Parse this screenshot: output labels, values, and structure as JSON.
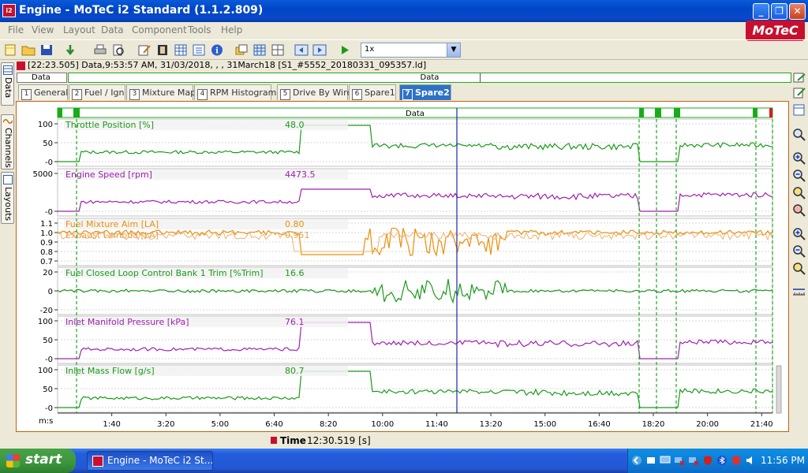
{
  "window": {
    "title": "Engine - MoTeC i2 Standard (1.1.2.809)"
  },
  "menu": [
    "File",
    "View",
    "Layout",
    "Data",
    "Component",
    "Tools",
    "Help"
  ],
  "logo": "MoTeC",
  "toolbar": {
    "zoom": "1x"
  },
  "file_info": "[22:23.505] Data,9:53:57 AM, 31/03/2018, , , 31March18 [S1_#5552_20180331_095357.ld]",
  "side_tabs": [
    "Data",
    "Channels",
    "Layouts"
  ],
  "data_row": {
    "left": "Data",
    "center": "Data"
  },
  "tabs": [
    {
      "num": "1",
      "label": "General"
    },
    {
      "num": "2",
      "label": "Fuel / Ign"
    },
    {
      "num": "3",
      "label": "Mixture Map"
    },
    {
      "num": "4",
      "label": "RPM Histogram"
    },
    {
      "num": "5",
      "label": "Drive By Wire"
    },
    {
      "num": "6",
      "label": "Spare1"
    },
    {
      "num": "7",
      "label": "Spare2"
    }
  ],
  "graph": {
    "header_label": "Data",
    "x_unit": "m:s",
    "x_ticks": [
      "1:40",
      "3:20",
      "5:00",
      "6:40",
      "8:20",
      "10:00",
      "11:40",
      "13:20",
      "15:00",
      "16:40",
      "18:20",
      "20:00",
      "21:40"
    ],
    "cursor_label": "Time",
    "cursor_value": "12:30.519 [s]",
    "panes": [
      {
        "name": "Throttle Position [%]",
        "value": "48.0",
        "color": "#1a9a1a",
        "ticks": [
          "100",
          "50",
          "-0"
        ],
        "kind": "throttle"
      },
      {
        "name": "Engine Speed [rpm]",
        "value": "4473.5",
        "color": "#a020b0",
        "ticks": [
          "5000",
          "-0"
        ],
        "kind": "rpm"
      },
      {
        "name": "Fuel Mixture Aim [LA]",
        "value": "0.80",
        "color": "#e8900a",
        "ticks": [
          "1.1",
          "1.0",
          "0.9",
          "0.8",
          "0.7"
        ],
        "kind": "lambda",
        "name2": "Exhaust Lambda [LA]",
        "value2": "0.951"
      },
      {
        "name": "Fuel Closed Loop Control Bank 1 Trim [%Trim]",
        "value": "16.6",
        "color": "#1a9a1a",
        "ticks": [
          "20",
          "0",
          "-20"
        ],
        "kind": "trim"
      },
      {
        "name": "Inlet Manifold Pressure [kPa]",
        "value": "76.1",
        "color": "#a020b0",
        "ticks": [
          "100",
          "50",
          "-0"
        ],
        "kind": "map"
      },
      {
        "name": "Inlet Mass Flow [g/s]",
        "value": "80.7",
        "color": "#1a9a1a",
        "ticks": [
          "100",
          "50",
          "-0"
        ],
        "kind": "flow"
      }
    ]
  },
  "taskbar": {
    "start": "start",
    "task": "Engine - MoTeC i2 St...",
    "clock": "11:56 PM"
  }
}
